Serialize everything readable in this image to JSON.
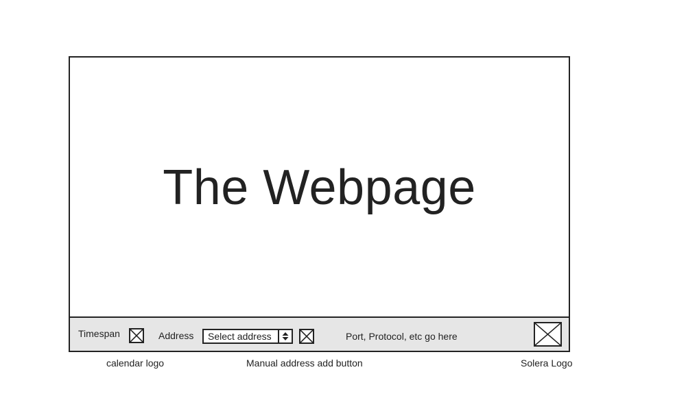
{
  "page": {
    "heading": "The Webpage"
  },
  "toolbar": {
    "timespan_label": "Timespan",
    "calendar_icon": "calendar-placeholder-icon",
    "address_label": "Address",
    "address_select": {
      "selected": "Select address"
    },
    "add_address_icon": "add-address-placeholder-icon",
    "info_text": "Port, Protocol, etc go here",
    "logo_icon": "solera-logo-placeholder"
  },
  "annotations": {
    "calendar": "calendar logo",
    "manual_add": "Manual address add button",
    "logo": "Solera Logo"
  },
  "colors": {
    "stroke": "#222222",
    "toolbar_bg": "#e6e6e6",
    "background": "#ffffff"
  }
}
